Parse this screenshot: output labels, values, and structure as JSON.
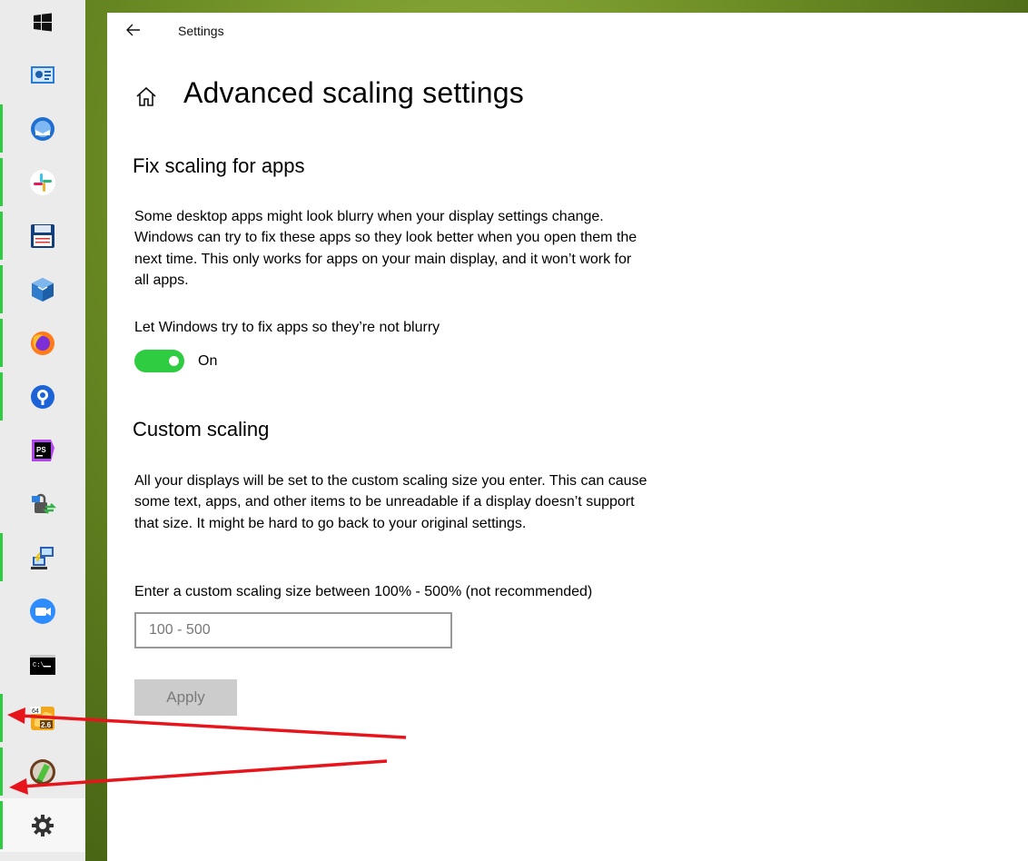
{
  "window": {
    "title": "Settings",
    "back_icon": "back-arrow-icon",
    "home_icon": "home-icon"
  },
  "page": {
    "title": "Advanced scaling settings"
  },
  "fix_scaling": {
    "heading": "Fix scaling for apps",
    "description": "Some desktop apps might look blurry when your display settings change. Windows can try to fix these apps so they look better when you open them the next time. This only works for apps on your main display, and it won’t work for all apps.",
    "toggle_label": "Let Windows try to fix apps so they’re not blurry",
    "toggle_state": "On",
    "toggle_on": true
  },
  "custom_scaling": {
    "heading": "Custom scaling",
    "description": "All your displays will be set to the custom scaling size you enter. This can cause some text, apps, and other items to be unreadable if a display doesn’t support that size. It might be hard to go back to your original settings.",
    "input_label": "Enter a custom scaling size between 100% - 500% (not recommended)",
    "input_placeholder": "100 - 500",
    "input_value": "",
    "apply_label": "Apply"
  },
  "taskbar": {
    "items": [
      {
        "icon": "windows-start-icon",
        "running": false
      },
      {
        "icon": "control-panel-icon",
        "running": false
      },
      {
        "icon": "thunderbird-icon",
        "running": true
      },
      {
        "icon": "slack-icon",
        "running": true
      },
      {
        "icon": "floppy-save-icon",
        "running": true
      },
      {
        "icon": "virtualbox-icon",
        "running": true
      },
      {
        "icon": "firefox-icon",
        "running": true
      },
      {
        "icon": "sourcetree-icon",
        "running": true
      },
      {
        "icon": "phpstorm-icon",
        "running": false
      },
      {
        "icon": "vpn-lock-icon",
        "running": false
      },
      {
        "icon": "network-computer-icon",
        "running": true
      },
      {
        "icon": "zoom-icon",
        "running": false
      },
      {
        "icon": "command-prompt-icon",
        "running": false
      },
      {
        "icon": "app-64bit-icon",
        "running": true,
        "badge_top": "64",
        "badge_bottom": "2.6"
      },
      {
        "icon": "green-book-icon",
        "running": true
      },
      {
        "icon": "settings-gear-icon",
        "running": true
      }
    ]
  },
  "colors": {
    "accent_green": "#2ecc40",
    "annotation_red": "#e8141b",
    "disabled_button": "#cccccc"
  }
}
